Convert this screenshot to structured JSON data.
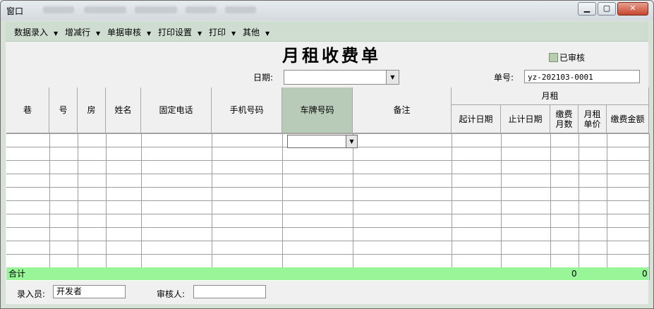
{
  "window": {
    "title": "窗口",
    "min_label": "▁",
    "max_label": "▢",
    "close_label": "✕"
  },
  "menu": [
    {
      "label": "数据录入"
    },
    {
      "label": "增减行"
    },
    {
      "label": "单据审核"
    },
    {
      "label": "打印设置"
    },
    {
      "label": "打印"
    },
    {
      "label": "其他"
    }
  ],
  "header": {
    "doc_title": "月租收费单",
    "audited_label": "已审核",
    "date_label": "日期:",
    "date_value": "",
    "no_label": "单号:",
    "no_value": "yz-202103-0001"
  },
  "table": {
    "columns": [
      "巷",
      "号",
      "房",
      "姓名",
      "固定电话",
      "手机号码",
      "车牌号码",
      "备注"
    ],
    "group_label": "月租",
    "sub_columns": [
      "起计日期",
      "止计日期",
      "缴费\n月数",
      "月租\n单价",
      "缴费金额"
    ],
    "sum_label": "合计",
    "sum_months": "0",
    "sum_amount": "0"
  },
  "footer": {
    "entry_label": "录入员:",
    "entry_value": "开发者",
    "reviewer_label": "审核人:",
    "reviewer_value": ""
  },
  "colors": {
    "accent": "#98f598",
    "menubar": "#cfdcd0",
    "selected_header": "#b8cbb8"
  }
}
